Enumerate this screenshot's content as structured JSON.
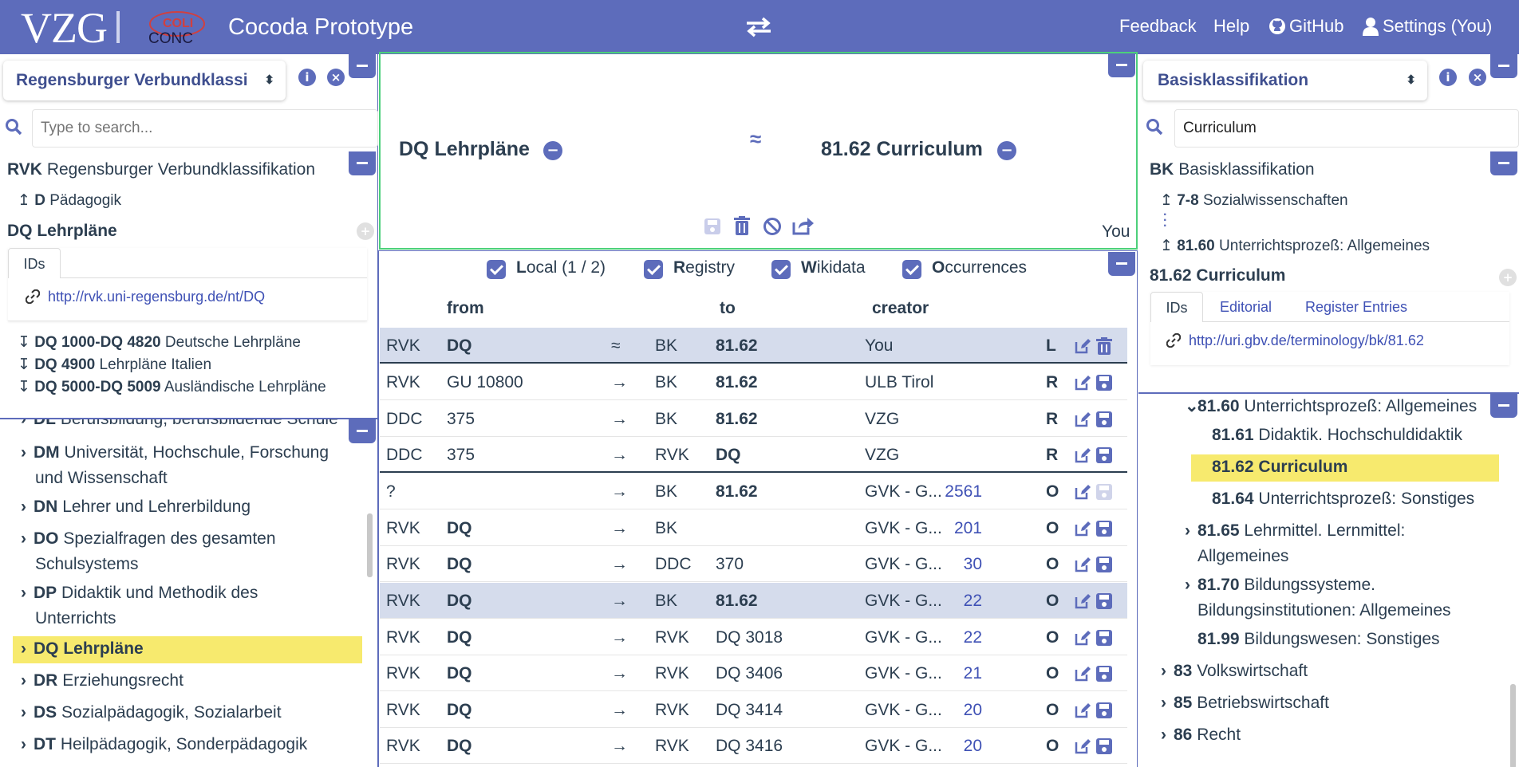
{
  "header": {
    "logo_text": "VZG",
    "coli_logo_text_top": "COLI",
    "coli_logo_text_bottom": "CONC",
    "app_title": "Cocoda Prototype",
    "swap_icon": "exchange-arrows-icon",
    "nav": {
      "feedback": "Feedback",
      "help": "Help",
      "github": "GitHub",
      "settings": "Settings (You)"
    }
  },
  "left": {
    "scheme_select": "Regensburger Verbundklassi",
    "search_placeholder": "Type to search...",
    "scheme_notation": "RVK",
    "scheme_label": "Regensburger Verbundklassifikation",
    "ancestor_notation": "D",
    "ancestor_label": "Pädagogik",
    "concept_notation": "DQ",
    "concept_label": "Lehrpläne",
    "tab_ids": "IDs",
    "uri": "http://rvk.uni-regensburg.de/nt/DQ",
    "narrower": [
      {
        "notation": "DQ 1000-DQ 4820",
        "label": "Deutsche Lehrpläne"
      },
      {
        "notation": "DQ 4900",
        "label": "Lehrpläne Italien"
      },
      {
        "notation": "DQ 5000-DQ 5009",
        "label": "Ausländische Lehrpläne"
      }
    ],
    "tree": [
      {
        "notation": "DL",
        "label": "Berufsbildung, berufsbildende Schule",
        "label2": ""
      },
      {
        "notation": "DM",
        "label": "Universität, Hochschule, Forschung",
        "label2": "und Wissenschaft"
      },
      {
        "notation": "DN",
        "label": "Lehrer und Lehrerbildung",
        "label2": ""
      },
      {
        "notation": "DO",
        "label": "Spezialfragen des gesamten",
        "label2": "Schulsystems"
      },
      {
        "notation": "DP",
        "label": "Didaktik und Methodik des",
        "label2": "Unterrichts"
      },
      {
        "notation": "DQ",
        "label": "Lehrpläne",
        "label2": ""
      },
      {
        "notation": "DR",
        "label": "Erziehungsrecht",
        "label2": ""
      },
      {
        "notation": "DS",
        "label": "Sozialpädagogik, Sozialarbeit",
        "label2": ""
      },
      {
        "notation": "DT",
        "label": "Heilpädagogik, Sonderpädagogik",
        "label2": ""
      }
    ]
  },
  "mapping_editor": {
    "source_notation": "DQ",
    "source_label": "Lehrpläne",
    "relation": "≈",
    "target_notation": "81.62",
    "target_label": "Curriculum",
    "creator": "You"
  },
  "mapping_browser": {
    "filters": [
      {
        "prefix": "L",
        "rest": "ocal (1 / 2)"
      },
      {
        "prefix": "R",
        "rest": "egistry"
      },
      {
        "prefix": "W",
        "rest": "ikidata"
      },
      {
        "prefix": "O",
        "rest": "ccurrences"
      }
    ],
    "col_from": "from",
    "col_to": "to",
    "col_creator": "creator",
    "rows": [
      {
        "fs": "RVK",
        "fc": "DQ",
        "fb": true,
        "rel": "≈",
        "ts": "BK",
        "tc": "81.62",
        "tb": true,
        "creator": "You",
        "count": "",
        "type": "L"
      },
      {
        "fs": "RVK",
        "fc": "GU 10800",
        "fb": false,
        "rel": "→",
        "ts": "BK",
        "tc": "81.62",
        "tb": true,
        "creator": "ULB Tirol",
        "count": "",
        "type": "R"
      },
      {
        "fs": "DDC",
        "fc": "375",
        "fb": false,
        "rel": "→",
        "ts": "BK",
        "tc": "81.62",
        "tb": true,
        "creator": "VZG",
        "count": "",
        "type": "R"
      },
      {
        "fs": "DDC",
        "fc": "375",
        "fb": false,
        "rel": "→",
        "ts": "RVK",
        "tc": "DQ",
        "tb": true,
        "creator": "VZG",
        "count": "",
        "type": "R"
      },
      {
        "fs": "?",
        "fc": "",
        "fb": false,
        "rel": "→",
        "ts": "BK",
        "tc": "81.62",
        "tb": true,
        "creator": "GVK - G...",
        "count": "2561",
        "type": "O"
      },
      {
        "fs": "RVK",
        "fc": "DQ",
        "fb": true,
        "rel": "→",
        "ts": "BK",
        "tc": "",
        "tb": false,
        "creator": "GVK - G...",
        "count": "201",
        "type": "O"
      },
      {
        "fs": "RVK",
        "fc": "DQ",
        "fb": true,
        "rel": "→",
        "ts": "DDC",
        "tc": "370",
        "tb": false,
        "creator": "GVK - G...",
        "count": "30",
        "type": "O"
      },
      {
        "fs": "RVK",
        "fc": "DQ",
        "fb": true,
        "rel": "→",
        "ts": "BK",
        "tc": "81.62",
        "tb": true,
        "creator": "GVK - G...",
        "count": "22",
        "type": "O"
      },
      {
        "fs": "RVK",
        "fc": "DQ",
        "fb": true,
        "rel": "→",
        "ts": "RVK",
        "tc": "DQ 3018",
        "tb": false,
        "creator": "GVK - G...",
        "count": "22",
        "type": "O"
      },
      {
        "fs": "RVK",
        "fc": "DQ",
        "fb": true,
        "rel": "→",
        "ts": "RVK",
        "tc": "DQ 3406",
        "tb": false,
        "creator": "GVK - G...",
        "count": "21",
        "type": "O"
      },
      {
        "fs": "RVK",
        "fc": "DQ",
        "fb": true,
        "rel": "→",
        "ts": "RVK",
        "tc": "DQ 3414",
        "tb": false,
        "creator": "GVK - G...",
        "count": "20",
        "type": "O"
      },
      {
        "fs": "RVK",
        "fc": "DQ",
        "fb": true,
        "rel": "→",
        "ts": "RVK",
        "tc": "DQ 3416",
        "tb": false,
        "creator": "GVK - G...",
        "count": "20",
        "type": "O"
      }
    ]
  },
  "right": {
    "scheme_select": "Basisklassifikation",
    "search_value": "Curriculum",
    "scheme_notation": "BK",
    "scheme_label": "Basisklassifikation",
    "ancestor1_notation": "7-8",
    "ancestor1_label": "Sozialwissenschaften",
    "ancestor2_notation": "81.60",
    "ancestor2_label": "Unterrichtsprozeß: Allgemeines",
    "concept_notation": "81.62",
    "concept_label": "Curriculum",
    "tabs": [
      "IDs",
      "Editorial",
      "Register Entries"
    ],
    "uri": "http://uri.gbv.de/terminology/bk/81.62",
    "tree": [
      {
        "notation": "81.60",
        "label": "Unterrichtsprozeß: Allgemeines",
        "label2": ""
      },
      {
        "notation": "81.61",
        "label": "Didaktik. Hochschuldidaktik",
        "label2": ""
      },
      {
        "notation": "81.62",
        "label": "Curriculum",
        "label2": ""
      },
      {
        "notation": "81.64",
        "label": "Unterrichtsprozeß: Sonstiges",
        "label2": ""
      },
      {
        "notation": "81.65",
        "label": "Lehrmittel. Lernmittel:",
        "label2": "Allgemeines"
      },
      {
        "notation": "81.70",
        "label": "Bildungssysteme.",
        "label2": "Bildungsinstitutionen: Allgemeines"
      },
      {
        "notation": "81.99",
        "label": "Bildungswesen: Sonstiges",
        "label2": ""
      },
      {
        "notation": "83",
        "label": "Volkswirtschaft",
        "label2": ""
      },
      {
        "notation": "85",
        "label": "Betriebswirtschaft",
        "label2": ""
      },
      {
        "notation": "86",
        "label": "Recht",
        "label2": ""
      }
    ]
  },
  "colors": {
    "brand": "#5d6cbb",
    "highlight": "#f7ea6e",
    "selected_row": "#d5dcec",
    "link": "#3f51b5"
  }
}
